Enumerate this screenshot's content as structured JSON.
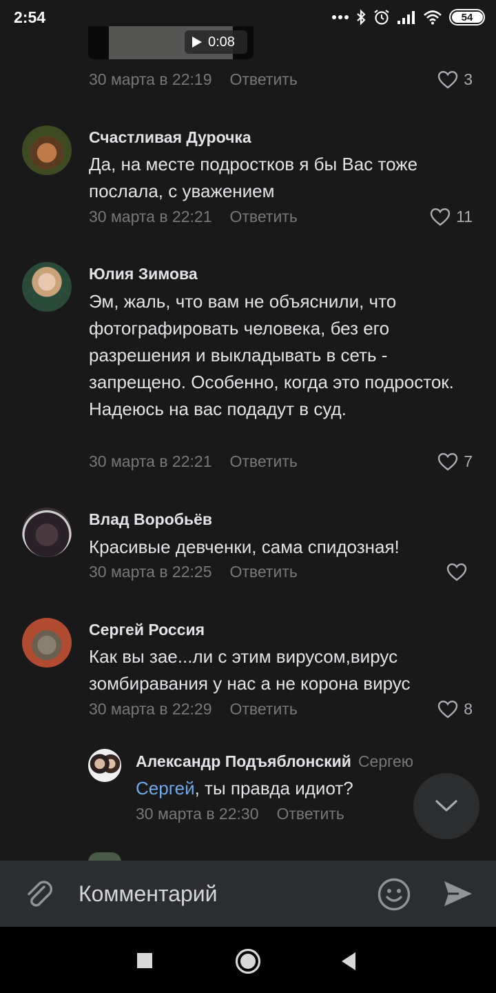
{
  "status_bar": {
    "time": "2:54",
    "battery": "54",
    "battery_level": 0.54
  },
  "video": {
    "duration": "0:08"
  },
  "first_meta": {
    "date": "30 марта в 22:19",
    "reply": "Ответить",
    "likes": "3"
  },
  "comments": [
    {
      "author": "Счастливая Дурочка",
      "text": "Да, на месте подростков я бы Вас тоже послала, с уважением",
      "date": "30 марта в 22:21",
      "reply": "Ответить",
      "likes": "11"
    },
    {
      "author": "Юлия Зимова",
      "text": "Эм, жаль, что вам не объяснили, что фотографировать человека, без его разрешения и выкладывать в сеть - запрещено. Особенно, когда это подросток. Надеюсь на вас подадут в суд.",
      "date": "30 марта в 22:21",
      "reply": "Ответить",
      "likes": "7"
    },
    {
      "author": "Влад Воробьёв",
      "text": "Красивые девченки, сама спидозная!",
      "date": "30 марта в 22:25",
      "reply": "Ответить",
      "likes": ""
    },
    {
      "author": "Сергей Россия",
      "text": "Как вы зае...ли с этим вирусом,вирус зомбиравания у нас а не корона вирус",
      "date": "30 марта в 22:29",
      "reply": "Ответить",
      "likes": "8"
    }
  ],
  "nested_reply": {
    "author": "Александр Подъяблонский",
    "reply_to": "Сергею",
    "mention": "Сергей",
    "text": ", ты правда идиот?",
    "date": "30 марта в 22:30",
    "reply": "Ответить"
  },
  "composer": {
    "placeholder": "Комментарий"
  },
  "icons": {
    "like": "heart-outline-icon",
    "attach": "paperclip-icon",
    "emoji": "smiley-icon",
    "send": "send-arrow-icon",
    "scroll_down": "chevron-down-icon"
  },
  "colors": {
    "background": "#19191a",
    "accent": "#71aaeb",
    "secondary_text": "#76787a"
  }
}
